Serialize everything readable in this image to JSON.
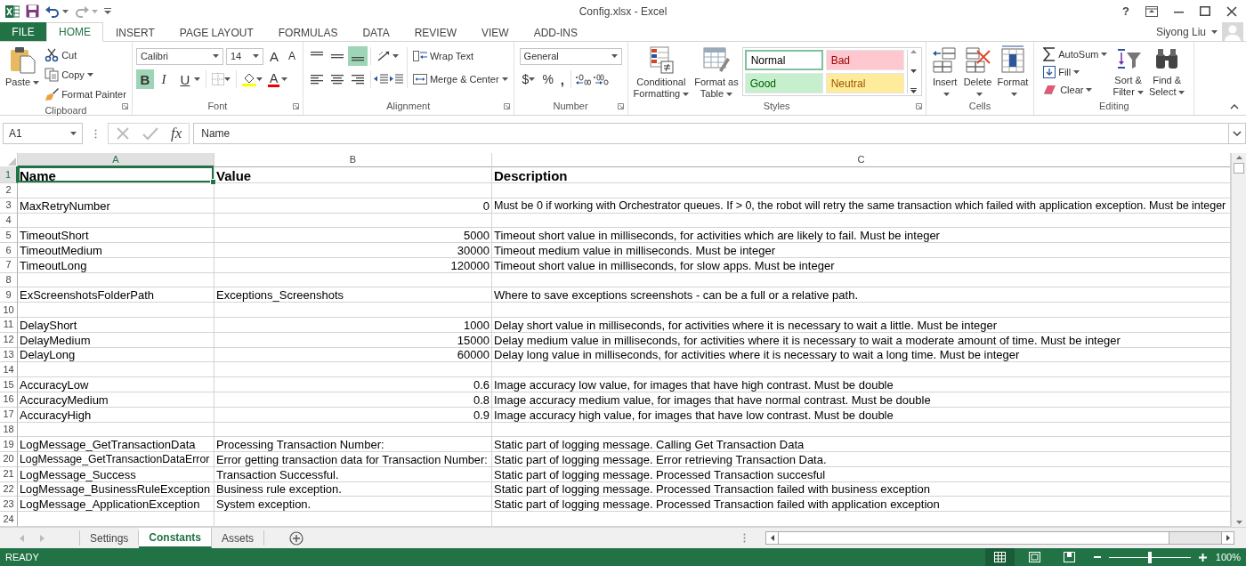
{
  "window": {
    "title": "Config.xlsx - Excel",
    "help": "?"
  },
  "ribbon_tabs": [
    {
      "label": "FILE",
      "kind": "file",
      "selected": false
    },
    {
      "label": "HOME",
      "kind": "tab",
      "selected": true
    },
    {
      "label": "INSERT",
      "kind": "tab",
      "selected": false
    },
    {
      "label": "PAGE LAYOUT",
      "kind": "tab",
      "selected": false
    },
    {
      "label": "FORMULAS",
      "kind": "tab",
      "selected": false
    },
    {
      "label": "DATA",
      "kind": "tab",
      "selected": false
    },
    {
      "label": "REVIEW",
      "kind": "tab",
      "selected": false
    },
    {
      "label": "VIEW",
      "kind": "tab",
      "selected": false
    },
    {
      "label": "ADD-INS",
      "kind": "tab",
      "selected": false
    }
  ],
  "account": {
    "name": "Siyong Liu"
  },
  "clipboard": {
    "label": "Clipboard",
    "paste": "Paste",
    "cut": "Cut",
    "copy": "Copy",
    "format_painter": "Format Painter"
  },
  "font": {
    "label": "Font",
    "name": "Calibri",
    "size": "14",
    "grow": "A",
    "shrink": "A",
    "font_color": "A",
    "styles": [
      {
        "kind": "bold",
        "label": "B",
        "selected": true
      },
      {
        "kind": "italic",
        "label": "I",
        "selected": false
      },
      {
        "kind": "underline",
        "label": "U",
        "selected": false
      }
    ]
  },
  "alignment": {
    "label": "Alignment",
    "wrap_text": "Wrap Text",
    "merge": "Merge & Center",
    "vertical": [
      {
        "kind": "top",
        "selected": false
      },
      {
        "kind": "middle",
        "selected": false
      },
      {
        "kind": "bottom",
        "selected": true
      }
    ],
    "horizontal": [
      {
        "kind": "left",
        "selected": false
      },
      {
        "kind": "center",
        "selected": false
      },
      {
        "kind": "right",
        "selected": false
      }
    ]
  },
  "number": {
    "label": "Number",
    "format": "General",
    "currency": "$",
    "percent": "%",
    "comma": ","
  },
  "styles": {
    "label": "Styles",
    "conditional": [
      "Conditional",
      "Formatting"
    ],
    "table": [
      "Format as",
      "Table"
    ],
    "gallery": [
      {
        "label": "Normal",
        "kind": "normal",
        "selected": true,
        "color": "#ffffff"
      },
      {
        "label": "Bad",
        "kind": "bad",
        "selected": false,
        "color": "#ffc7ce"
      },
      {
        "label": "Good",
        "kind": "good",
        "selected": false,
        "color": "#c6efce"
      },
      {
        "label": "Neutral",
        "kind": "neutral",
        "selected": false,
        "color": "#ffeb9c"
      }
    ]
  },
  "cells": {
    "label": "Cells",
    "buttons": [
      {
        "kind": "insert",
        "label": "Insert"
      },
      {
        "kind": "delete",
        "label": "Delete"
      },
      {
        "kind": "format",
        "label": "Format"
      }
    ]
  },
  "editing": {
    "label": "Editing",
    "autosum": "AutoSum",
    "fill": "Fill",
    "clear": "Clear",
    "sort": [
      "Sort &",
      "Filter"
    ],
    "find": [
      "Find &",
      "Select"
    ]
  },
  "formula_bar": {
    "name_box": "A1",
    "fx": "fx",
    "value": "Name"
  },
  "sheet": {
    "columns": [
      {
        "label": "A",
        "selected": true
      },
      {
        "label": "B",
        "selected": false
      },
      {
        "label": "C",
        "selected": false
      }
    ],
    "rows": [
      {
        "number": "1",
        "kind": "header",
        "selected": true,
        "name": "Name",
        "value": "Value",
        "numeric": false,
        "description": "Description"
      },
      {
        "number": "2",
        "kind": "empty",
        "selected": false
      },
      {
        "number": "3",
        "kind": "data",
        "selected": false,
        "name": "MaxRetryNumber",
        "value": "0",
        "numeric": true,
        "description": "Must be 0 if working with Orchestrator queues. If > 0, the robot will retry the same transaction which failed with application exception. Must be integer"
      },
      {
        "number": "4",
        "kind": "empty",
        "selected": false
      },
      {
        "number": "5",
        "kind": "data",
        "selected": false,
        "name": "TimeoutShort",
        "value": "5000",
        "numeric": true,
        "description": "Timeout short value in milliseconds, for activities which are likely to fail. Must be integer"
      },
      {
        "number": "6",
        "kind": "data",
        "selected": false,
        "name": "TimeoutMedium",
        "value": "30000",
        "numeric": true,
        "description": "Timeout medium value in milliseconds. Must be integer"
      },
      {
        "number": "7",
        "kind": "data",
        "selected": false,
        "name": "TimeoutLong",
        "value": "120000",
        "numeric": true,
        "description": "Timeout short value in milliseconds, for slow apps. Must be integer"
      },
      {
        "number": "8",
        "kind": "empty",
        "selected": false
      },
      {
        "number": "9",
        "kind": "data",
        "selected": false,
        "name": "ExScreenshotsFolderPath",
        "value": "Exceptions_Screenshots",
        "numeric": false,
        "description": "Where to save exceptions screenshots - can be a full or a relative path."
      },
      {
        "number": "10",
        "kind": "empty",
        "selected": false
      },
      {
        "number": "11",
        "kind": "data",
        "selected": false,
        "name": "DelayShort",
        "value": "1000",
        "numeric": true,
        "description": "Delay short value in milliseconds, for activities where it is necessary to wait a little. Must be integer"
      },
      {
        "number": "12",
        "kind": "data",
        "selected": false,
        "name": "DelayMedium",
        "value": "15000",
        "numeric": true,
        "description": "Delay medium value in milliseconds, for activities where it is necessary to wait a moderate amount of time. Must be integer"
      },
      {
        "number": "13",
        "kind": "data",
        "selected": false,
        "name": "DelayLong",
        "value": "60000",
        "numeric": true,
        "description": "Delay long value in milliseconds, for activities where it is necessary to wait a long time. Must be integer"
      },
      {
        "number": "14",
        "kind": "empty",
        "selected": false
      },
      {
        "number": "15",
        "kind": "data",
        "selected": false,
        "name": "AccuracyLow",
        "value": "0.6",
        "numeric": true,
        "description": "Image accuracy low value, for images that have high contrast. Must be double"
      },
      {
        "number": "16",
        "kind": "data",
        "selected": false,
        "name": "AccuracyMedium",
        "value": "0.8",
        "numeric": true,
        "description": "Image accuracy medium value, for images that have normal contrast. Must be double"
      },
      {
        "number": "17",
        "kind": "data",
        "selected": false,
        "name": "AccuracyHigh",
        "value": "0.9",
        "numeric": true,
        "description": "Image accuracy high value, for images that have low contrast. Must be double"
      },
      {
        "number": "18",
        "kind": "empty",
        "selected": false
      },
      {
        "number": "19",
        "kind": "data",
        "selected": false,
        "name": "LogMessage_GetTransactionData",
        "value": "Processing Transaction Number:",
        "numeric": false,
        "description": "Static part of logging message. Calling Get Transaction Data"
      },
      {
        "number": "20",
        "kind": "data",
        "selected": false,
        "name": "LogMessage_GetTransactionDataError",
        "value": "Error getting transaction data for Transaction Number:",
        "numeric": false,
        "description": "Static part of logging message. Error retrieving Transaction Data."
      },
      {
        "number": "21",
        "kind": "data",
        "selected": false,
        "name": "LogMessage_Success",
        "value": "Transaction Successful.",
        "numeric": false,
        "description": "Static part of logging message. Processed Transaction succesful"
      },
      {
        "number": "22",
        "kind": "data",
        "selected": false,
        "name": "LogMessage_BusinessRuleException",
        "value": "Business rule exception.",
        "numeric": false,
        "description": "Static part of logging message. Processed Transaction failed with business exception"
      },
      {
        "number": "23",
        "kind": "data",
        "selected": false,
        "name": "LogMessage_ApplicationException",
        "value": "System exception.",
        "numeric": false,
        "description": "Static part of logging message. Processed Transaction failed with application exception"
      },
      {
        "number": "24",
        "kind": "empty",
        "selected": false
      }
    ]
  },
  "sheet_tabs": [
    {
      "label": "Settings",
      "selected": false
    },
    {
      "label": "Constants",
      "selected": true
    },
    {
      "label": "Assets",
      "selected": false
    }
  ],
  "status_bar": {
    "mode": "READY",
    "views": [
      {
        "kind": "normal",
        "selected": true
      },
      {
        "kind": "page_layout",
        "selected": false
      },
      {
        "kind": "page_break",
        "selected": false
      }
    ],
    "zoom": {
      "level": 0.5,
      "label": "100%"
    }
  }
}
